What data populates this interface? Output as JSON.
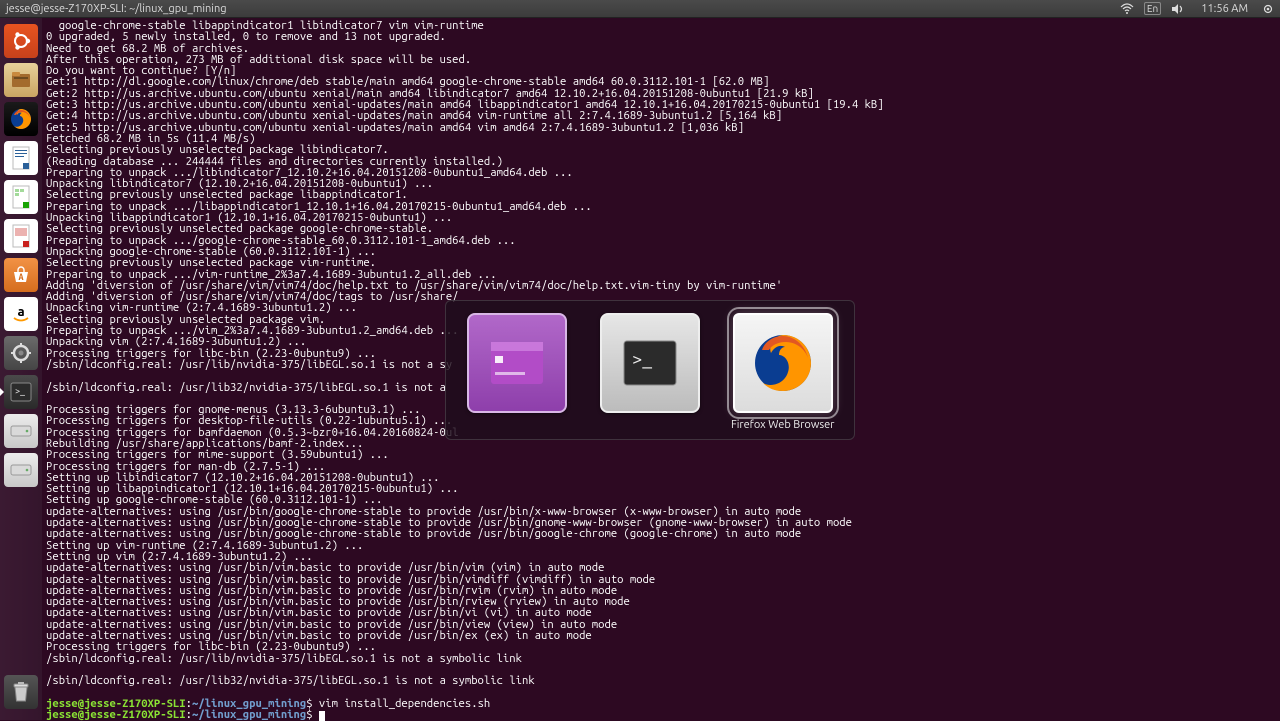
{
  "menubar": {
    "title": "jesse@jesse-Z170XP-SLI: ~/linux_gpu_mining",
    "clock": "11:56 AM",
    "lang": "En"
  },
  "launcher": {
    "items": [
      {
        "name": "ubuntu-dash-icon"
      },
      {
        "name": "files-icon"
      },
      {
        "name": "firefox-icon"
      },
      {
        "name": "writer-icon"
      },
      {
        "name": "calc-icon"
      },
      {
        "name": "impress-icon"
      },
      {
        "name": "software-center-icon"
      },
      {
        "name": "amazon-icon"
      },
      {
        "name": "settings-icon"
      },
      {
        "name": "terminal-icon"
      },
      {
        "name": "disk1-icon"
      },
      {
        "name": "disk2-icon"
      }
    ],
    "trash": {
      "name": "trash-icon"
    }
  },
  "terminal": {
    "lines": [
      "  google-chrome-stable libappindicator1 libindicator7 vim vim-runtime",
      "0 upgraded, 5 newly installed, 0 to remove and 13 not upgraded.",
      "Need to get 68.2 MB of archives.",
      "After this operation, 273 MB of additional disk space will be used.",
      "Do you want to continue? [Y/n]",
      "Get:1 http://dl.google.com/linux/chrome/deb stable/main amd64 google-chrome-stable amd64 60.0.3112.101-1 [62.0 MB]",
      "Get:2 http://us.archive.ubuntu.com/ubuntu xenial/main amd64 libindicator7 amd64 12.10.2+16.04.20151208-0ubuntu1 [21.9 kB]",
      "Get:3 http://us.archive.ubuntu.com/ubuntu xenial-updates/main amd64 libappindicator1 amd64 12.10.1+16.04.20170215-0ubuntu1 [19.4 kB]",
      "Get:4 http://us.archive.ubuntu.com/ubuntu xenial-updates/main amd64 vim-runtime all 2:7.4.1689-3ubuntu1.2 [5,164 kB]",
      "Get:5 http://us.archive.ubuntu.com/ubuntu xenial-updates/main amd64 vim amd64 2:7.4.1689-3ubuntu1.2 [1,036 kB]",
      "Fetched 68.2 MB in 5s (11.4 MB/s)",
      "Selecting previously unselected package libindicator7.",
      "(Reading database ... 244444 files and directories currently installed.)",
      "Preparing to unpack .../libindicator7_12.10.2+16.04.20151208-0ubuntu1_amd64.deb ...",
      "Unpacking libindicator7 (12.10.2+16.04.20151208-0ubuntu1) ...",
      "Selecting previously unselected package libappindicator1.",
      "Preparing to unpack .../libappindicator1_12.10.1+16.04.20170215-0ubuntu1_amd64.deb ...",
      "Unpacking libappindicator1 (12.10.1+16.04.20170215-0ubuntu1) ...",
      "Selecting previously unselected package google-chrome-stable.",
      "Preparing to unpack .../google-chrome-stable_60.0.3112.101-1_amd64.deb ...",
      "Unpacking google-chrome-stable (60.0.3112.101-1) ...",
      "Selecting previously unselected package vim-runtime.",
      "Preparing to unpack .../vim-runtime_2%3a7.4.1689-3ubuntu1.2_all.deb ...",
      "Adding 'diversion of /usr/share/vim/vim74/doc/help.txt to /usr/share/vim/vim74/doc/help.txt.vim-tiny by vim-runtime'",
      "Adding 'diversion of /usr/share/vim/vim74/doc/tags to /usr/share/",
      "Unpacking vim-runtime (2:7.4.1689-3ubuntu1.2) ...",
      "Selecting previously unselected package vim.",
      "Preparing to unpack .../vim_2%3a7.4.1689-3ubuntu1.2_amd64.deb ...",
      "Unpacking vim (2:7.4.1689-3ubuntu1.2) ...",
      "Processing triggers for libc-bin (2.23-0ubuntu9) ...",
      "/sbin/ldconfig.real: /usr/lib/nvidia-375/libEGL.so.1 is not a sy",
      "",
      "/sbin/ldconfig.real: /usr/lib32/nvidia-375/libEGL.so.1 is not a ",
      "",
      "Processing triggers for gnome-menus (3.13.3-6ubuntu3.1) ...",
      "Processing triggers for desktop-file-utils (0.22-1ubuntu5.1) ...",
      "Processing triggers for bamfdaemon (0.5.3~bzr0+16.04.20160824-0ul",
      "Rebuilding /usr/share/applications/bamf-2.index...",
      "Processing triggers for mime-support (3.59ubuntu1) ...",
      "Processing triggers for man-db (2.7.5-1) ...",
      "Setting up libindicator7 (12.10.2+16.04.20151208-0ubuntu1) ...",
      "Setting up libappindicator1 (12.10.1+16.04.20170215-0ubuntu1) ...",
      "Setting up google-chrome-stable (60.0.3112.101-1) ...",
      "update-alternatives: using /usr/bin/google-chrome-stable to provide /usr/bin/x-www-browser (x-www-browser) in auto mode",
      "update-alternatives: using /usr/bin/google-chrome-stable to provide /usr/bin/gnome-www-browser (gnome-www-browser) in auto mode",
      "update-alternatives: using /usr/bin/google-chrome-stable to provide /usr/bin/google-chrome (google-chrome) in auto mode",
      "Setting up vim-runtime (2:7.4.1689-3ubuntu1.2) ...",
      "Setting up vim (2:7.4.1689-3ubuntu1.2) ...",
      "update-alternatives: using /usr/bin/vim.basic to provide /usr/bin/vim (vim) in auto mode",
      "update-alternatives: using /usr/bin/vim.basic to provide /usr/bin/vimdiff (vimdiff) in auto mode",
      "update-alternatives: using /usr/bin/vim.basic to provide /usr/bin/rvim (rvim) in auto mode",
      "update-alternatives: using /usr/bin/vim.basic to provide /usr/bin/rview (rview) in auto mode",
      "update-alternatives: using /usr/bin/vim.basic to provide /usr/bin/vi (vi) in auto mode",
      "update-alternatives: using /usr/bin/vim.basic to provide /usr/bin/view (view) in auto mode",
      "update-alternatives: using /usr/bin/vim.basic to provide /usr/bin/ex (ex) in auto mode",
      "Processing triggers for libc-bin (2.23-0ubuntu9) ...",
      "/sbin/ldconfig.real: /usr/lib/nvidia-375/libEGL.so.1 is not a symbolic link",
      "",
      "/sbin/ldconfig.real: /usr/lib32/nvidia-375/libEGL.so.1 is not a symbolic link",
      ""
    ],
    "prompt1": {
      "user": "jesse@jesse-Z170XP-SLI",
      "sep": ":",
      "path": "~/linux_gpu_mining",
      "dollar": "$ ",
      "cmd": "vim install_dependencies.sh"
    },
    "prompt2": {
      "user": "jesse@jesse-Z170XP-SLI",
      "sep": ":",
      "path": "~/linux_gpu_mining",
      "dollar": "$ "
    }
  },
  "switcher": {
    "selected_label": "Firefox Web Browser",
    "entries": [
      {
        "name": "app-switcher-files",
        "label": ""
      },
      {
        "name": "app-switcher-terminal",
        "label": ""
      },
      {
        "name": "app-switcher-firefox",
        "label": "Firefox Web Browser"
      }
    ]
  }
}
